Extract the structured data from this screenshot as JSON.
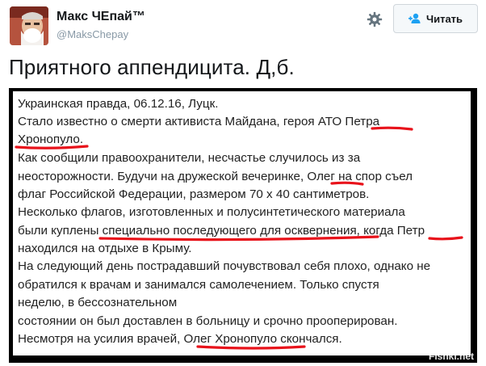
{
  "author": {
    "name": "Макс ЧЕпай™",
    "handle": "@MaksChepay"
  },
  "actions": {
    "settings_icon": "gear-icon",
    "follow_label": "Читать",
    "follow_icon": "add-user-icon"
  },
  "tweet": {
    "text": "Приятного аппендицита. Д,б."
  },
  "photo": {
    "lines": [
      "Украинская правда, 06.12.16, Луцк.",
      "Стало известно о смерти активиста Майдана, героя АТО Петра",
      "Хронопуло.",
      "Как сообщили правоохранители, несчастье случилось из за",
      "неосторожности. Будучи на дружеской вечеринке, Олег на спор съел",
      "флаг Российской Федерации, размером 70 х 40 сантиметров.",
      "Несколько флагов, изготовленных и полусинтетического материала",
      "были куплены специально последующего для осквернения, когда Петр",
      "находился на отдыхе в Крыму.",
      "На следующий день пострадавший почувствовал себя плохо, однако не",
      "обратился к врачам и занимался самолечением. Только спустя",
      "неделю, в бессознательном",
      "состоянии он был доставлен в больницу и срочно прооперирован.",
      "Несмотря на усилия врачей, Олег Хронопуло скончался."
    ],
    "watermark": "Fishki.net",
    "underline_color": "#e8131b"
  }
}
